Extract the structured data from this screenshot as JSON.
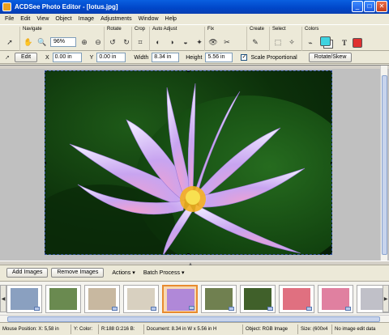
{
  "window": {
    "title": "ACDSee Photo Editor - [lotus.jpg]",
    "minimize": "_",
    "maximize": "□",
    "close": "✕"
  },
  "menu": [
    "File",
    "Edit",
    "View",
    "Object",
    "Image",
    "Adjustments",
    "Window",
    "Help"
  ],
  "toolbar": {
    "navigate_label": "Navigate",
    "zoom_value": "96%",
    "rotate_label": "Rotate",
    "crop_label": "Crop",
    "auto_adjust_label": "Auto Adjust",
    "fix_label": "Fix",
    "create_label": "Create",
    "select_label": "Select",
    "colors_label": "Colors",
    "text_tool": "T",
    "foreground_color": "#3fd3e0",
    "background_color": "#e03030"
  },
  "properties": {
    "edit_button": "Edit",
    "x_label": "X",
    "x_value": "0.00 in",
    "y_label": "Y",
    "y_value": "0.00 in",
    "width_label": "Width",
    "width_value": "8.34 in",
    "height_label": "Height",
    "height_value": "5.56 in",
    "scale_label": "Scale Proportional",
    "scale_checked": "✓",
    "rotate_skew_button": "Rotate/Skew"
  },
  "bottom_toolbar": {
    "add_images": "Add Images",
    "remove_images": "Remove Images",
    "actions": "Actions",
    "batch_process": "Batch Process"
  },
  "thumbnails": [
    {
      "name": "thumb-1",
      "color": "#8aa0c0",
      "selected": false,
      "folder": true
    },
    {
      "name": "thumb-2",
      "color": "#6a8a50",
      "selected": false,
      "folder": false
    },
    {
      "name": "thumb-3",
      "color": "#c8b8a0",
      "selected": false,
      "folder": true
    },
    {
      "name": "thumb-4",
      "color": "#d8d0c0",
      "selected": false,
      "folder": true
    },
    {
      "name": "thumb-5-lotus",
      "color": "#b088d8",
      "selected": true,
      "folder": true
    },
    {
      "name": "thumb-6",
      "color": "#708050",
      "selected": false,
      "folder": true
    },
    {
      "name": "thumb-7",
      "color": "#40602a",
      "selected": false,
      "folder": true
    },
    {
      "name": "thumb-8",
      "color": "#e07080",
      "selected": false,
      "folder": true
    },
    {
      "name": "thumb-9",
      "color": "#e080a0",
      "selected": false,
      "folder": true
    },
    {
      "name": "thumb-10",
      "color": "#c0c0c8",
      "selected": false,
      "folder": true
    }
  ],
  "status": {
    "mouse": "Mouse Position: X: 5,58 in",
    "ycolor": "Y: Color: ",
    "rgb": "R:188  G:216  B:",
    "document": "Document: 8.34 in W x 5.56 in H",
    "object": "Object: RGB Image",
    "size": "Size: (600x4",
    "edit": "No image edit data"
  }
}
